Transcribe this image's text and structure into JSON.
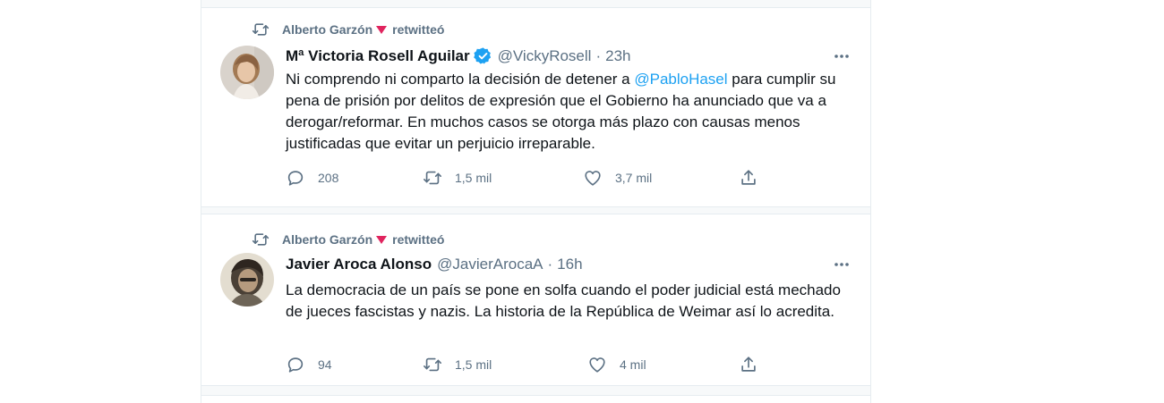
{
  "tweets": [
    {
      "retweeted_by": "Alberto Garzón",
      "retweeted_label": "retwitteó",
      "name": "Mª Victoria Rosell Aguilar",
      "verified": true,
      "handle": "@VickyRosell",
      "separator": "·",
      "time": "23h",
      "text_before": "Ni comprendo ni comparto la decisión de detener a ",
      "mention": "@PabloHasel",
      "text_after": " para cumplir su pena de prisión por delitos de expresión que el Gobierno ha anunciado que va a derogar/reformar. En muchos casos se otorga más plazo con causas menos justificadas que evitar un perjuicio irreparable.",
      "replies": "208",
      "retweets": "1,5 mil",
      "likes": "3,7 mil"
    },
    {
      "retweeted_by": "Alberto Garzón",
      "retweeted_label": "retwitteó",
      "name": "Javier Aroca Alonso",
      "verified": false,
      "handle": "@JavierArocaA",
      "separator": "·",
      "time": "16h",
      "text": "La democracia de un país se pone en solfa cuando el poder judicial está mechado de jueces fascistas y nazis. La historia de la República de Weimar así lo acredita.",
      "replies": "94",
      "retweets": "1,5 mil",
      "likes": "4 mil"
    }
  ],
  "colors": {
    "accent": "#1da1f2",
    "muted": "#5b7083",
    "heart": "#e0245e",
    "border": "#e6ecf0"
  },
  "icons": [
    "retweet-icon",
    "heart-triangle-icon",
    "verified-badge-icon",
    "more-icon",
    "reply-icon",
    "like-icon",
    "share-icon",
    "avatar"
  ]
}
